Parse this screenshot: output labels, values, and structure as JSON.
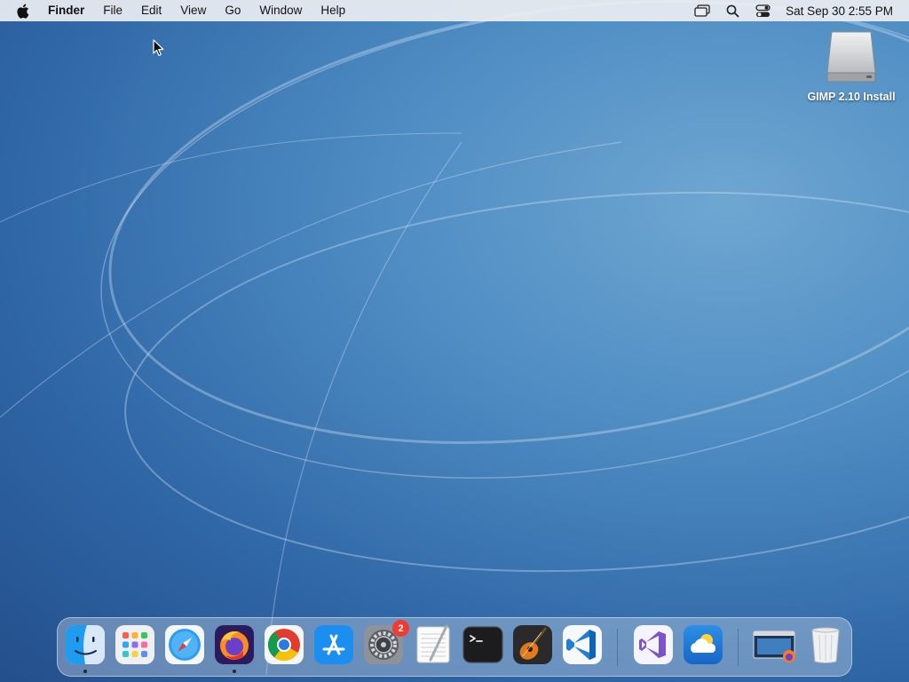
{
  "menubar": {
    "app_name": "Finder",
    "menus": [
      "File",
      "Edit",
      "View",
      "Go",
      "Window",
      "Help"
    ],
    "clock": "Sat Sep 30  2:55 PM",
    "status_icons": [
      "screen-mirroring-icon",
      "spotlight-search-icon",
      "control-center-icon"
    ]
  },
  "desktop": {
    "drive_label": "GIMP 2.10 Install",
    "drive_icon": "external-drive-icon"
  },
  "dock": {
    "items": [
      {
        "name": "Finder",
        "icon": "finder-icon",
        "running": true
      },
      {
        "name": "Launchpad",
        "icon": "launchpad-icon",
        "running": false
      },
      {
        "name": "Safari",
        "icon": "safari-icon",
        "running": false
      },
      {
        "name": "Firefox",
        "icon": "firefox-icon",
        "running": true
      },
      {
        "name": "Google Chrome",
        "icon": "chrome-icon",
        "running": false
      },
      {
        "name": "App Store",
        "icon": "app-store-icon",
        "running": false
      },
      {
        "name": "System Settings",
        "icon": "system-settings-icon",
        "running": false,
        "badge": "2"
      },
      {
        "name": "TextEdit",
        "icon": "textedit-icon",
        "running": false
      },
      {
        "name": "Terminal",
        "icon": "terminal-icon",
        "running": false
      },
      {
        "name": "GarageBand",
        "icon": "garageband-icon",
        "running": false
      },
      {
        "name": "Visual Studio Code",
        "icon": "vscode-icon",
        "running": false
      },
      {
        "name": "Visual Studio",
        "icon": "visual-studio-icon",
        "running": false
      },
      {
        "name": "Weather",
        "icon": "weather-icon",
        "running": false
      },
      {
        "name": "Firefox Window",
        "icon": "minimized-window-icon",
        "running": false
      },
      {
        "name": "Trash",
        "icon": "trash-icon",
        "running": false
      }
    ]
  },
  "colors": {
    "menubar_bg": "#eceef2",
    "wallpaper_center": "#6fa7d2",
    "wallpaper_edge": "#244f8c",
    "badge": "#f23a33"
  }
}
